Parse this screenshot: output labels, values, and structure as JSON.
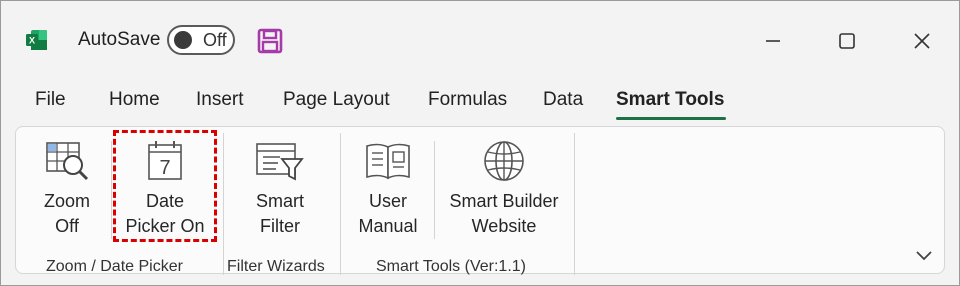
{
  "titlebar": {
    "autosave_label": "AutoSave",
    "autosave_state": "Off",
    "icons": [
      "excel-logo-icon",
      "save-icon",
      "minimize-icon",
      "maximize-icon",
      "close-icon"
    ]
  },
  "tabs": [
    "File",
    "Home",
    "Insert",
    "Page Layout",
    "Formulas",
    "Data",
    "Smart Tools"
  ],
  "active_tab": "Smart Tools",
  "ribbon": {
    "groups": [
      {
        "label": "Zoom / Date Picker",
        "buttons": [
          {
            "line1": "Zoom",
            "line2": "Off",
            "icon": "zoom-grid-icon"
          },
          {
            "line1": "Date",
            "line2": "Picker On",
            "icon": "calendar-icon",
            "calendar_day": "7"
          }
        ]
      },
      {
        "label": "Filter Wizards",
        "buttons": [
          {
            "line1": "Smart",
            "line2": "Filter",
            "icon": "filter-form-icon"
          }
        ]
      },
      {
        "label": "Smart Tools (Ver:1.1)",
        "buttons": [
          {
            "line1": "User",
            "line2": "Manual",
            "icon": "book-icon"
          },
          {
            "line1": "Smart Builder",
            "line2": "Website",
            "icon": "globe-icon"
          }
        ]
      }
    ]
  },
  "colors": {
    "excel_green": "#1e7145",
    "highlight": "#d90000",
    "save_purple": "#a43ba8"
  }
}
